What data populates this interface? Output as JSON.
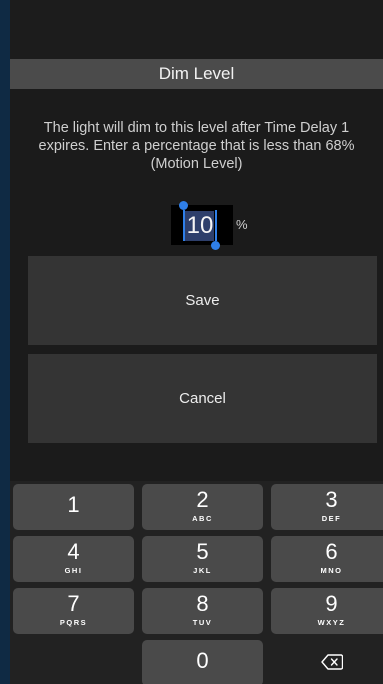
{
  "dialog": {
    "title": "Dim Level",
    "description": "The light will dim to this level after Time Delay 1 expires. Enter a percentage that is less than 68% (Motion Level)",
    "input_value": "10",
    "unit": "%"
  },
  "buttons": {
    "save_label": "Save",
    "cancel_label": "Cancel"
  },
  "keypad": {
    "keys": [
      {
        "digit": "1",
        "letters": ""
      },
      {
        "digit": "2",
        "letters": "ABC"
      },
      {
        "digit": "3",
        "letters": "DEF"
      },
      {
        "digit": "4",
        "letters": "GHI"
      },
      {
        "digit": "5",
        "letters": "JKL"
      },
      {
        "digit": "6",
        "letters": "MNO"
      },
      {
        "digit": "7",
        "letters": "PQRS"
      },
      {
        "digit": "8",
        "letters": "TUV"
      },
      {
        "digit": "9",
        "letters": "WXYZ"
      },
      {
        "digit": "0",
        "letters": ""
      }
    ],
    "delete_icon": "backspace-icon"
  },
  "colors": {
    "selection": "#2f7fe8",
    "key_background": "#4a4a4a",
    "button_background": "#343434"
  }
}
